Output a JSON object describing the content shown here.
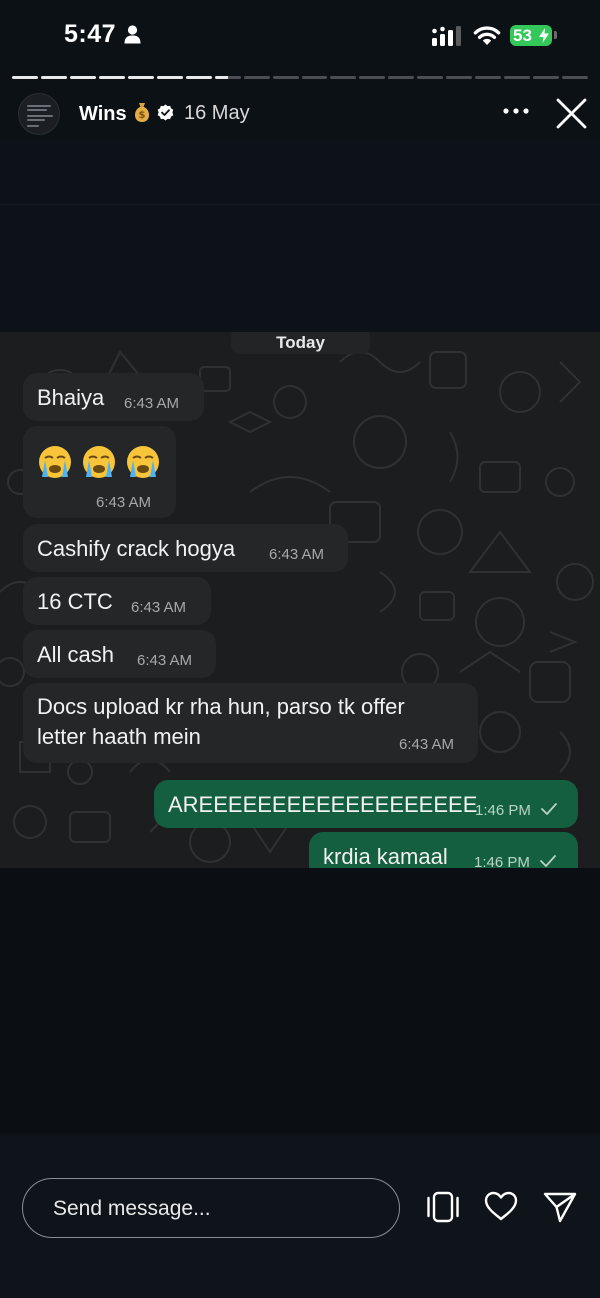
{
  "status_bar": {
    "time": "5:47",
    "battery": "53",
    "icons": [
      "person-icon",
      "signal-icon",
      "wifi-icon",
      "battery-icon"
    ]
  },
  "story": {
    "progress": {
      "segments": 20,
      "completed": 7.5
    },
    "username": "Wins",
    "username_emoji": "money-bag",
    "verified": true,
    "date": "16 May",
    "icons": [
      "more-icon",
      "close-icon"
    ]
  },
  "chat": {
    "day_label": "Today",
    "messages": [
      {
        "dir": "in",
        "text": "Bhaiya",
        "time": "6:43 AM"
      },
      {
        "dir": "in",
        "emoji": [
          "loudly-crying-face",
          "loudly-crying-face",
          "loudly-crying-face"
        ],
        "time": "6:43 AM"
      },
      {
        "dir": "in",
        "text": "Cashify crack hogya",
        "time": "6:43 AM"
      },
      {
        "dir": "in",
        "text": "16 CTC",
        "time": "6:43 AM"
      },
      {
        "dir": "in",
        "text": "All cash",
        "time": "6:43 AM"
      },
      {
        "dir": "in",
        "line1": "Docs upload kr rha hun, parso tk offer",
        "line2": "letter haath mein",
        "time": "6:43 AM"
      },
      {
        "dir": "out",
        "text": "AREEEEEEEEEEEEEEEEEEE",
        "time": "1:46 PM"
      },
      {
        "dir": "out",
        "text": "krdia kamaal",
        "time": "1:46 PM"
      }
    ],
    "colors": {
      "incoming": "#252627",
      "outgoing": "#135f3f",
      "background": "#1c1d1e"
    }
  },
  "footer": {
    "message_placeholder": "Send message...",
    "icons": [
      "gallery-icon",
      "heart-icon",
      "send-icon"
    ]
  }
}
